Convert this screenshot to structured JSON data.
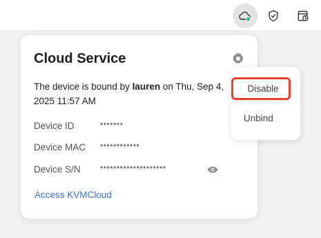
{
  "topbar": {
    "icons": [
      {
        "name": "cloud-icon",
        "status_color": "#1fbf8f"
      },
      {
        "name": "shield-check-icon"
      },
      {
        "name": "history-icon"
      }
    ]
  },
  "card": {
    "title": "Cloud Service",
    "bound_prefix": "The device is bound by ",
    "bound_user": "lauren",
    "bound_suffix": " on Thu, Sep 4, 2025 11:57 AM",
    "rows": [
      {
        "label": "Device ID",
        "value": "*******"
      },
      {
        "label": "Device MAC",
        "value": "************"
      },
      {
        "label": "Device S/N",
        "value": "********************"
      }
    ],
    "link_text": "Access KVMCloud"
  },
  "menu": {
    "items": [
      "Disable",
      "Unbind"
    ],
    "highlight_color": "#e0442c"
  },
  "colors": {
    "link": "#3a6fd1",
    "background": "#f1f1f1",
    "card": "#ffffff"
  }
}
